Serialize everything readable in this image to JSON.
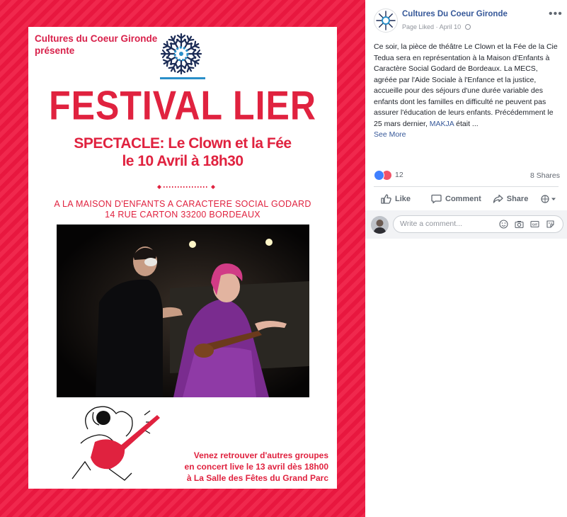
{
  "poster": {
    "org_line1": "Cultures du Coeur Gironde",
    "org_line2": "présente",
    "title": "FESTIVAL LIER",
    "spectacle_line": "SPECTACLE: Le Clown et la Fée",
    "date_line": "le 10 Avril à 18h30",
    "venue_line1": "A LA MAISON D'ENFANTS A CARACTERE SOCIAL GODARD",
    "venue_line2": "14 RUE CARTON 33200 BORDEAUX",
    "concert_line1": "Venez retrouver d'autres groupes",
    "concert_line2": "en concert live le 13 avril dès 18h00",
    "concert_line3": "à La Salle des Fêtes du Grand Parc"
  },
  "post": {
    "page_name": "Cultures Du Coeur Gironde",
    "page_status": "Page Liked",
    "date": "April 10",
    "text_before_mention": "Ce soir, la pièce de théâtre Le Clown et la Fée de la Cie Tedua sera en représentation à la Maison d'Enfants à Caractère Social Godard de Bordeaux. La MECS, agréée par l'Aide Sociale à l'Enfance et la justice, accueille pour des séjours d'une durée variable des enfants dont les familles en difficulté ne peuvent pas assurer l'éducation de leurs enfants. Précédemment le 25 mars dernier, ",
    "mention": "MAKJA",
    "text_after_mention": " était ...",
    "see_more": "See More",
    "reaction_count": "12",
    "shares": "8 Shares"
  },
  "actions": {
    "like": "Like",
    "comment": "Comment",
    "share": "Share"
  },
  "comment_box": {
    "placeholder": "Write a comment..."
  },
  "colors": {
    "brand_red": "#e0223f",
    "fb_link": "#365899",
    "like_blue": "#4080ff",
    "love_red": "#f25268"
  }
}
